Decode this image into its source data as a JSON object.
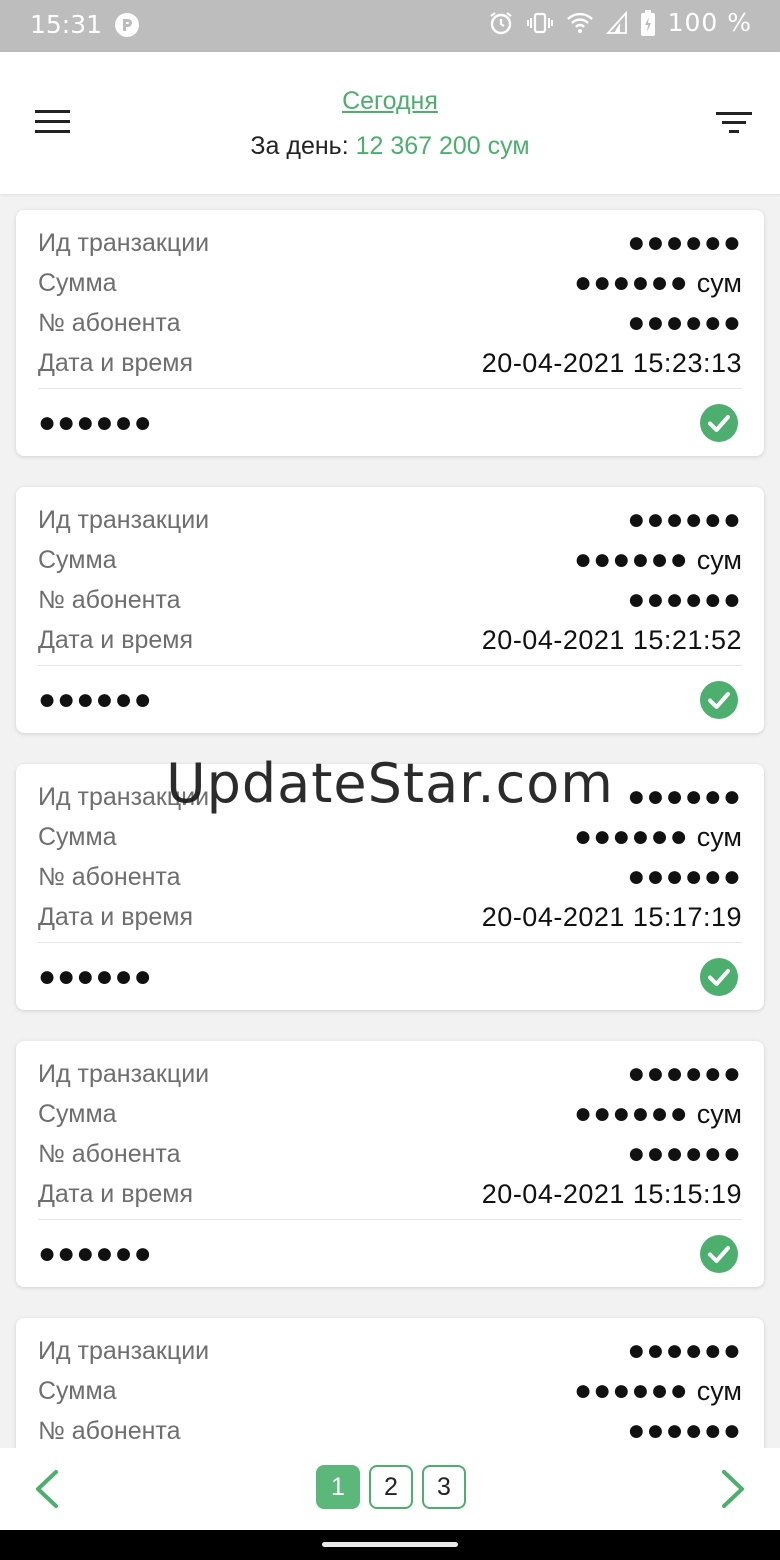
{
  "status_bar": {
    "time": "15:31",
    "battery": "100 %"
  },
  "header": {
    "title": "Сегодня",
    "per_day_label": "За день:",
    "per_day_amount": "12 367 200 сум"
  },
  "labels": {
    "transaction_id": "Ид транзакции",
    "amount": "Сумма",
    "subscriber": "№ абонента",
    "datetime": "Дата и время"
  },
  "masked": "●●●●●●",
  "currency": "сум",
  "transactions": [
    {
      "datetime": "20-04-2021 15:23:13",
      "status": "success"
    },
    {
      "datetime": "20-04-2021 15:21:52",
      "status": "success"
    },
    {
      "datetime": "20-04-2021 15:17:19",
      "status": "success"
    },
    {
      "datetime": "20-04-2021 15:15:19",
      "status": "success"
    },
    {
      "datetime": "",
      "status": "success"
    }
  ],
  "pagination": {
    "pages": [
      "1",
      "2",
      "3"
    ],
    "current": "1"
  },
  "watermark": "UpdateStar.com",
  "colors": {
    "accent": "#4caf6d",
    "status_bar": "#bdbdbd"
  },
  "icons": {
    "menu": "hamburger-icon",
    "filter": "filter-icon",
    "status": "check-circle-icon",
    "prev": "chevron-left-icon",
    "next": "chevron-right-icon"
  }
}
